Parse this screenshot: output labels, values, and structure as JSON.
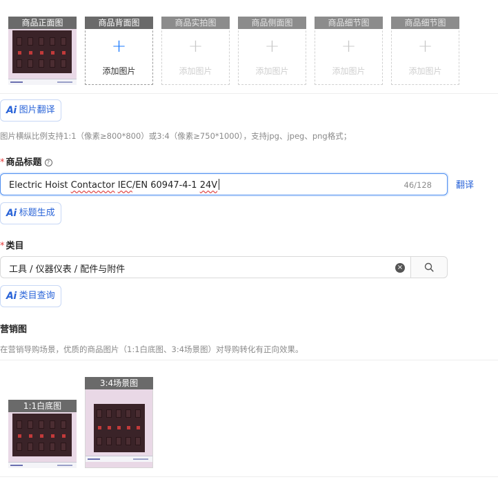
{
  "image_slots": [
    {
      "label": "商品正面图",
      "filled": true
    },
    {
      "label": "商品背面图",
      "add_text": "添加图片",
      "plus": "+",
      "active": true
    },
    {
      "label": "商品实拍图",
      "add_text": "添加图片",
      "plus": "+"
    },
    {
      "label": "商品侧面图",
      "add_text": "添加图片",
      "plus": "+"
    },
    {
      "label": "商品细节图",
      "add_text": "添加图片",
      "plus": "+"
    },
    {
      "label": "商品细节图",
      "add_text": "添加图片",
      "plus": "+"
    }
  ],
  "ai_icon": "Ai",
  "image_translate": {
    "button_label": "图片翻译"
  },
  "image_hint": "图片横纵比例支持1:1（像素≥800*800）或3:4（像素≥750*1000），支持jpg、jpeg、png格式；",
  "title_field": {
    "required_mark": "*",
    "label": "商品标题",
    "help_icon": "?",
    "value_parts": [
      "Electric Hoist ",
      "Contactor",
      " ",
      "IEC",
      "/EN 60947-4-1 ",
      "24V"
    ],
    "char_count": "46/128",
    "translate_link": "翻译",
    "generate_button": "标题生成"
  },
  "category_field": {
    "required_mark": "*",
    "label": "类目",
    "value": "工具 / 仪器仪表 / 配件与附件",
    "clear_icon": "×",
    "query_button": "类目查询"
  },
  "marketing": {
    "label": "营销图",
    "hint": "在营销导购场景，优质的商品图片（1:1白底图、3:4场景图）对导购转化有正向效果。",
    "images": [
      {
        "label": "1:1白底图"
      },
      {
        "label": "3:4场景图"
      }
    ]
  },
  "colors": {
    "accent": "#2a64d8",
    "required": "#e23b3b",
    "focus_border": "#4b8cf0"
  }
}
